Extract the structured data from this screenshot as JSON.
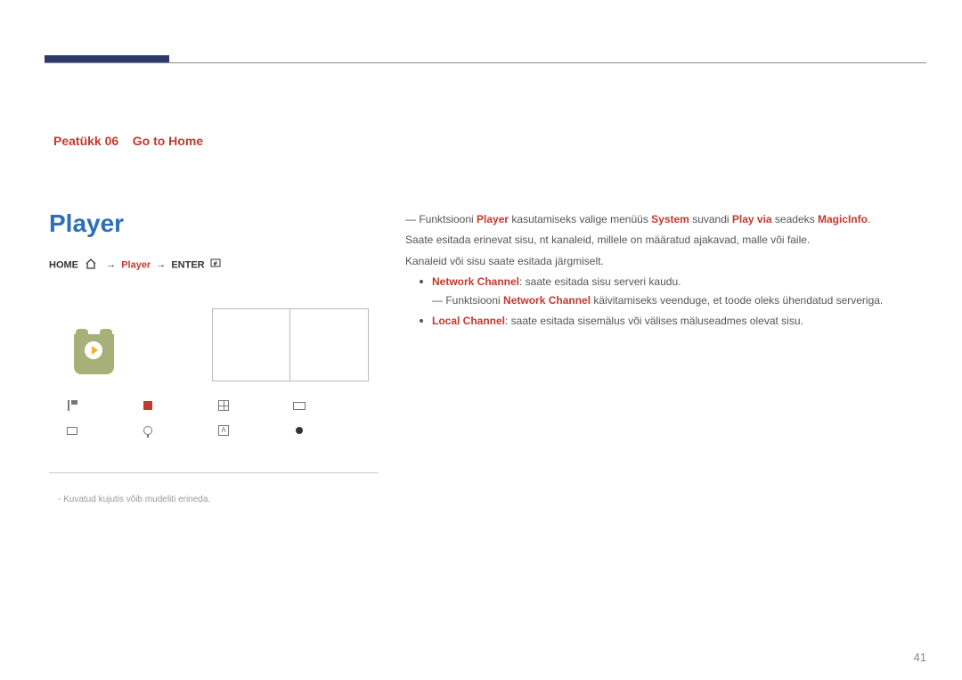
{
  "chapter": {
    "num": "Peatükk 06",
    "title": "Go to Home"
  },
  "title": "Player",
  "nav": {
    "home": "HOME",
    "player": "Player",
    "enter": "ENTER",
    "homeIconAlt": "home-icon"
  },
  "thumbs": [
    "",
    ""
  ],
  "iconNames": [
    "flag-icon",
    "stop-icon",
    "grid-icon",
    "rect-icon",
    "square-icon",
    "pin-icon",
    "a-box-icon",
    "dot-icon"
  ],
  "footnote": "- Kuvatud kujutis võib mudeliti erineda.",
  "body": {
    "line1a": "― Funktsiooni ",
    "line1b": "Player",
    "line1c": " kasutamiseks valige menüüs ",
    "line1d": "System",
    "line1e": " suvandi ",
    "line1f": "Play via",
    "line1g": " seadeks ",
    "line1h": "MagicInfo",
    "line1i": ".",
    "line2": "Saate esitada erinevat sisu, nt kanaleid, millele on määratud ajakavad, malle või faile.",
    "line3": "Kanaleid või sisu saate esitada järgmiselt.",
    "b1_label": "Network Channel",
    "b1_text": ": saate esitada sisu serveri kaudu.",
    "sub1a": "― Funktsiooni ",
    "sub1b": "Network Channel",
    "sub1c": " käivitamiseks veenduge, et toode oleks ühendatud serveriga.",
    "b2_label": "Local Channel",
    "b2_text": ": saate esitada sisemälus või välises mäluseadmes olevat sisu."
  },
  "pageNum": "41"
}
